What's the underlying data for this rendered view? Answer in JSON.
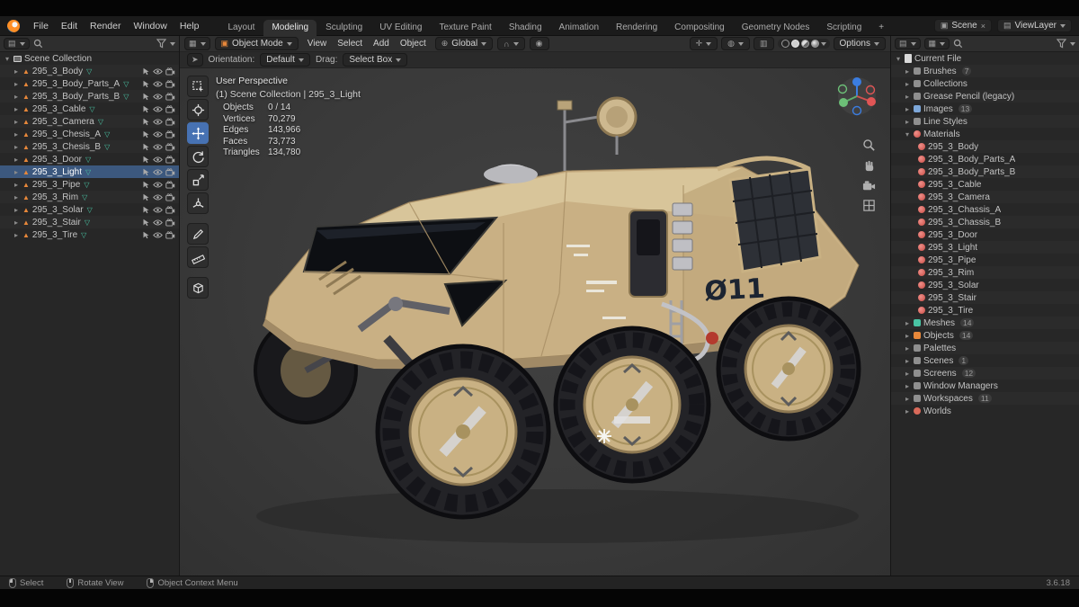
{
  "topbar": {
    "menus": [
      "File",
      "Edit",
      "Render",
      "Window",
      "Help"
    ],
    "tabs": [
      {
        "label": "Layout"
      },
      {
        "label": "Modeling",
        "active": true
      },
      {
        "label": "Sculpting"
      },
      {
        "label": "UV Editing"
      },
      {
        "label": "Texture Paint"
      },
      {
        "label": "Shading"
      },
      {
        "label": "Animation"
      },
      {
        "label": "Rendering"
      },
      {
        "label": "Compositing"
      },
      {
        "label": "Geometry Nodes"
      },
      {
        "label": "Scripting"
      },
      {
        "label": "+"
      }
    ],
    "scene_label": "Scene",
    "viewlayer_label": "ViewLayer"
  },
  "outliner": {
    "root_label": "Scene Collection",
    "items": [
      {
        "name": "295_3_Body"
      },
      {
        "name": "295_3_Body_Parts_A"
      },
      {
        "name": "295_3_Body_Parts_B"
      },
      {
        "name": "295_3_Cable"
      },
      {
        "name": "295_3_Camera"
      },
      {
        "name": "295_3_Chesis_A"
      },
      {
        "name": "295_3_Chesis_B"
      },
      {
        "name": "295_3_Door"
      },
      {
        "name": "295_3_Light",
        "selected": true
      },
      {
        "name": "295_3_Pipe"
      },
      {
        "name": "295_3_Rim"
      },
      {
        "name": "295_3_Solar"
      },
      {
        "name": "295_3_Stair"
      },
      {
        "name": "295_3_Tire"
      }
    ]
  },
  "viewport": {
    "header": {
      "mode": "Object Mode",
      "menus": [
        "View",
        "Select",
        "Add",
        "Object"
      ],
      "orientation": "Global",
      "options_label": "Options"
    },
    "tool_settings": {
      "orientation_label": "Orientation:",
      "orientation_value": "Default",
      "drag_label": "Drag:",
      "drag_value": "Select Box"
    },
    "overlay": {
      "perspective": "User Perspective",
      "context": "(1) Scene Collection | 295_3_Light",
      "stats": [
        {
          "label": "Objects",
          "value": "0 / 14"
        },
        {
          "label": "Vertices",
          "value": "70,279"
        },
        {
          "label": "Edges",
          "value": "143,966"
        },
        {
          "label": "Faces",
          "value": "73,773"
        },
        {
          "label": "Triangles",
          "value": "134,780"
        }
      ]
    },
    "decal_text": "Ø11"
  },
  "right_panel": {
    "root_label": "Current File",
    "sections_before": [
      {
        "name": "Brushes",
        "count": "7",
        "icon": "brushes-icon"
      },
      {
        "name": "Collections",
        "count": "",
        "icon": "collections-icon"
      },
      {
        "name": "Grease Pencil (legacy)",
        "count": "",
        "icon": "grease-pencil-icon"
      },
      {
        "name": "Images",
        "count": "13",
        "icon": "images-icon"
      },
      {
        "name": "Line Styles",
        "count": "",
        "icon": "line-styles-icon"
      }
    ],
    "materials_label": "Materials",
    "materials": [
      "295_3_Body",
      "295_3_Body_Parts_A",
      "295_3_Body_Parts_B",
      "295_3_Cable",
      "295_3_Camera",
      "295_3_Chassis_A",
      "295_3_Chassis_B",
      "295_3_Door",
      "295_3_Light",
      "295_3_Pipe",
      "295_3_Rim",
      "295_3_Solar",
      "295_3_Stair",
      "295_3_Tire"
    ],
    "sections_after": [
      {
        "name": "Meshes",
        "count": "14",
        "icon": "meshes-icon"
      },
      {
        "name": "Objects",
        "count": "14",
        "icon": "objects-icon"
      },
      {
        "name": "Palettes",
        "count": "",
        "icon": "palettes-icon"
      },
      {
        "name": "Scenes",
        "count": "1",
        "icon": "scenes-icon"
      },
      {
        "name": "Screens",
        "count": "12",
        "icon": "screens-icon"
      },
      {
        "name": "Window Managers",
        "count": "",
        "icon": "window-managers-icon"
      },
      {
        "name": "Workspaces",
        "count": "11",
        "icon": "workspaces-icon"
      },
      {
        "name": "Worlds",
        "count": "",
        "icon": "worlds-icon"
      }
    ]
  },
  "statusbar": {
    "select": "Select",
    "rotate": "Rotate View",
    "context_menu": "Object Context Menu",
    "version": "3.6.18"
  },
  "colors": {
    "accent": "#4772b3",
    "selection": "#3c587e",
    "body_tan": "#c9b084",
    "tire": "#232327"
  }
}
